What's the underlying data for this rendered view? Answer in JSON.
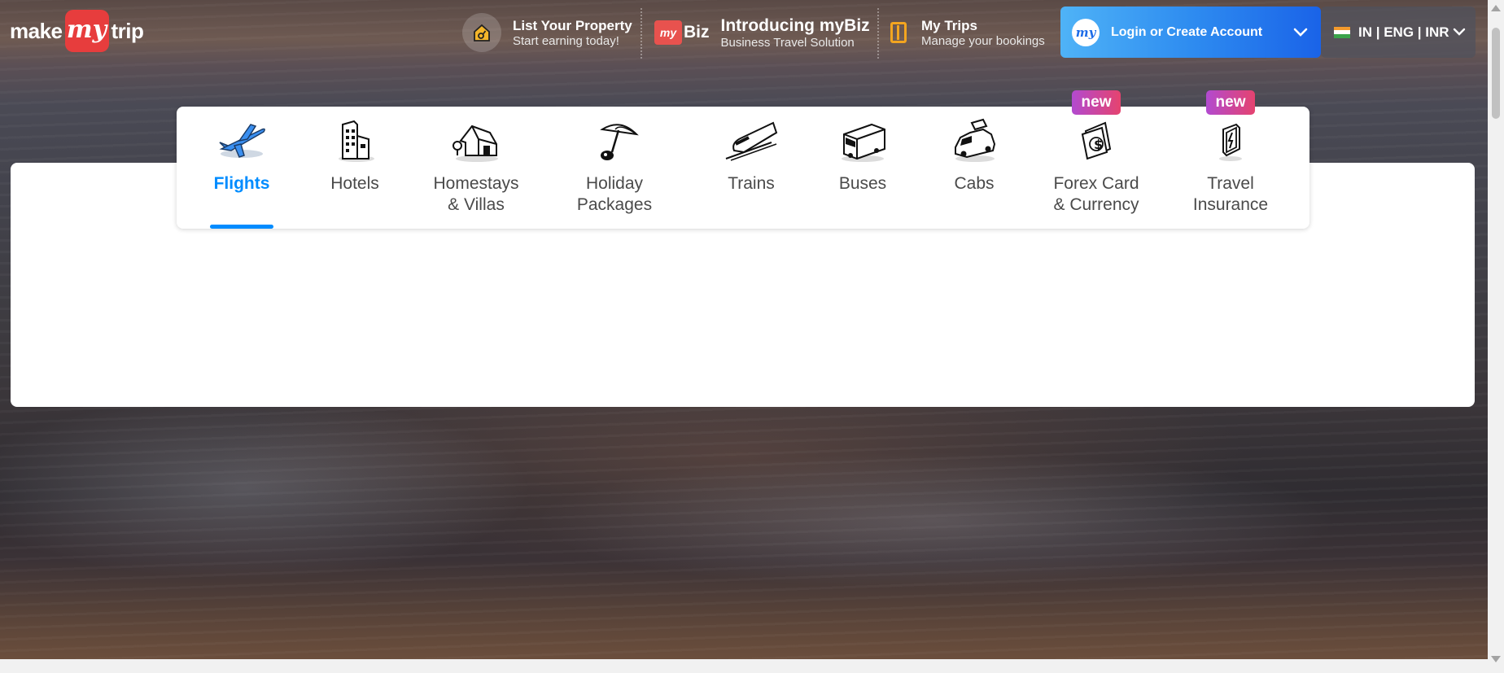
{
  "logo": {
    "part1": "make",
    "part2": "my",
    "part3": "trip"
  },
  "header": {
    "list_property": {
      "title": "List Your Property",
      "subtitle": "Start earning today!"
    },
    "mybiz": {
      "badge": "Biz",
      "badge_my": "my",
      "title": "Introducing myBiz",
      "subtitle": "Business Travel Solution"
    },
    "my_trips": {
      "title": "My Trips",
      "subtitle": "Manage your bookings"
    },
    "login": {
      "label": "Login or Create Account",
      "avatar": "my"
    },
    "locale": {
      "label": "IN | ENG | INR"
    }
  },
  "tabs": [
    {
      "label": "Flights",
      "icon": "airplane-icon",
      "active": true
    },
    {
      "label": "Hotels",
      "icon": "hotel-building-icon"
    },
    {
      "label": "Homestays\n& Villas",
      "icon": "house-icon"
    },
    {
      "label": "Holiday\nPackages",
      "icon": "beach-umbrella-icon"
    },
    {
      "label": "Trains",
      "icon": "train-icon"
    },
    {
      "label": "Buses",
      "icon": "bus-icon"
    },
    {
      "label": "Cabs",
      "icon": "cab-icon"
    },
    {
      "label": "Forex Card\n& Currency",
      "icon": "forex-card-icon",
      "badge": "new"
    },
    {
      "label": "Travel\nInsurance",
      "icon": "insurance-shield-icon",
      "badge": "new"
    }
  ],
  "colors": {
    "accent": "#008cff",
    "brand_red": "#e73d3d",
    "badge_gradient": [
      "#b24ad0",
      "#e5436f"
    ]
  }
}
